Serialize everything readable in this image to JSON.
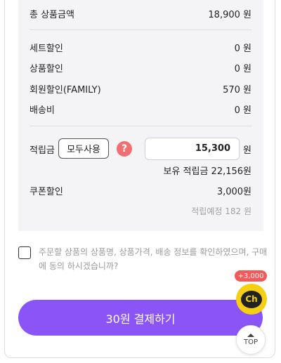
{
  "summary": {
    "total_label": "총 상품금액",
    "total_value": "18,900 원",
    "set_discount_label": "세트할인",
    "set_discount_value": "0 원",
    "product_discount_label": "상품할인",
    "product_discount_value": "0 원",
    "member_discount_label": "회원할인(FAMILY)",
    "member_discount_value": "570 원",
    "shipping_label": "배송비",
    "shipping_value": "0 원"
  },
  "points": {
    "label": "적립금",
    "use_all_label": "모두사용",
    "help_symbol": "?",
    "input_value": "15,300",
    "unit": "원",
    "held_text": "보유 적립금 22,156원"
  },
  "coupon": {
    "label": "쿠폰할인",
    "value": "3,000원",
    "expected_points": "적립예정 182 원"
  },
  "consent": {
    "text": "주문할 상품의 상품명, 상품가격, 배송 정보를 확인하였으며, 구매에 동의 하시겠습니까?"
  },
  "pay_button": {
    "label": "30원 결제하기"
  },
  "floating": {
    "badge_text": "+3,000",
    "chat_text": "Ch",
    "top_label": "TOP"
  },
  "colors": {
    "accent": "#8a54f7",
    "help": "#ef6f73",
    "chat": "#f5cf12",
    "badge": "#f25a5a"
  }
}
